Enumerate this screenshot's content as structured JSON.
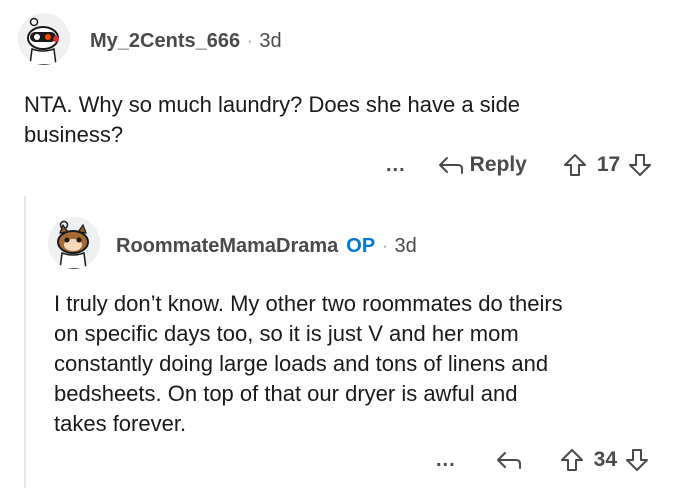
{
  "comments": [
    {
      "username": "My_2Cents_666",
      "separator": "·",
      "age": "3d",
      "text_lines": [
        "NTA. Why so much laundry? Does she have a side",
        "business?"
      ],
      "more_label": "...",
      "reply_label": "Reply",
      "score": "17"
    },
    {
      "username": "RoommateMamaDrama",
      "op_badge": "OP",
      "separator": "·",
      "age": "3d",
      "text_lines": [
        "I truly don’t know. My other two roommates do theirs",
        "on specific days too, so it is just V and her mom",
        "constantly doing large loads and tons of linens and",
        "bedsheets. On top of that our dryer is awful and",
        "takes forever."
      ],
      "more_label": "...",
      "score": "34"
    }
  ],
  "colors": {
    "accent_op": "#0079d3",
    "text": "#1a1a1b",
    "muted": "#4a4a4a",
    "line": "#e6e7e8"
  }
}
